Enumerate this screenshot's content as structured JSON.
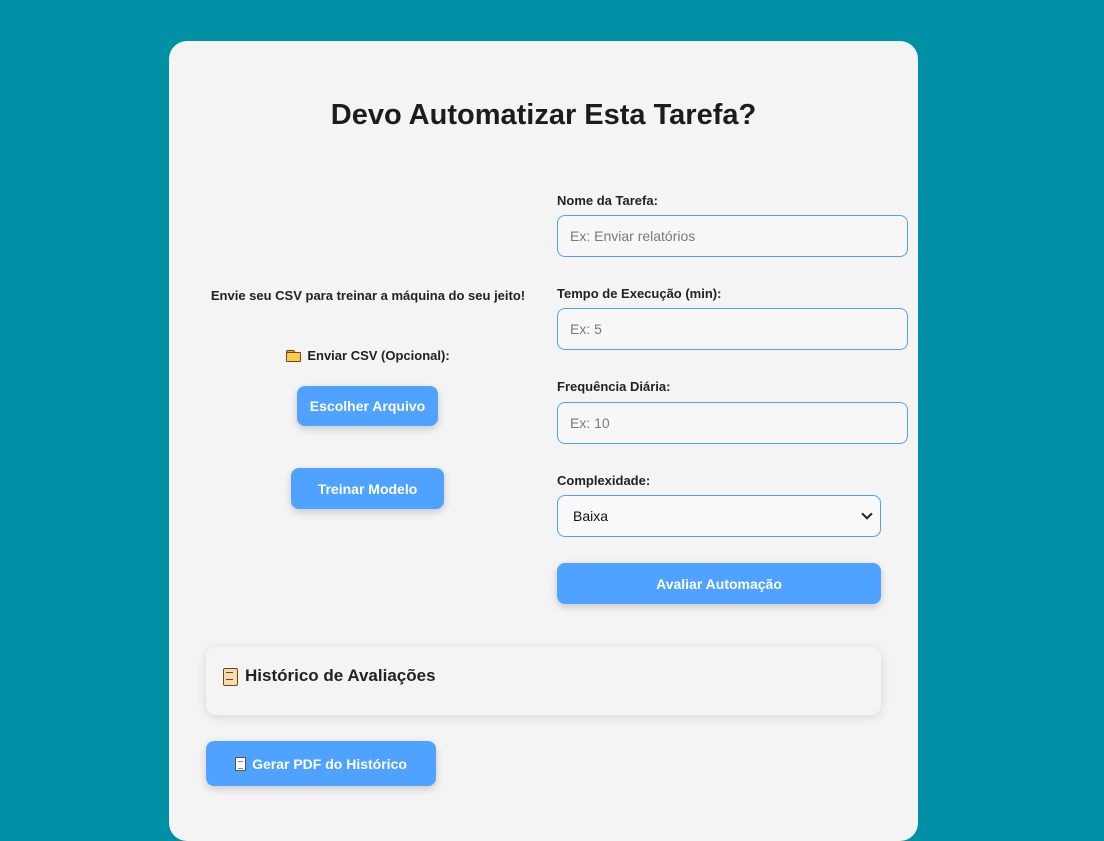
{
  "page": {
    "title": "Devo Automatizar Esta Tarefa?",
    "background_color": "#0090a5",
    "accent_color": "#4fa2ff"
  },
  "upload": {
    "tagline": "Envie seu CSV para treinar a máquina do seu jeito!",
    "label": "Enviar CSV (Opcional):",
    "label_icon": "folder-icon",
    "choose_file_button": "Escolher Arquivo",
    "train_button": "Treinar Modelo"
  },
  "form": {
    "task_name": {
      "label": "Nome da Tarefa:",
      "placeholder": "Ex: Enviar relatórios",
      "value": ""
    },
    "execution_time": {
      "label": "Tempo de Execução (min):",
      "placeholder": "Ex: 5",
      "value": ""
    },
    "daily_frequency": {
      "label": "Frequência Diária:",
      "placeholder": "Ex: 10",
      "value": ""
    },
    "complexity": {
      "label": "Complexidade:",
      "selected": "Baixa"
    },
    "evaluate_button": "Avaliar Automação"
  },
  "history": {
    "title": "Histórico de Avaliações",
    "title_icon": "scroll-icon"
  },
  "pdf_button": {
    "label": "Gerar PDF do Histórico",
    "icon": "document-icon"
  }
}
